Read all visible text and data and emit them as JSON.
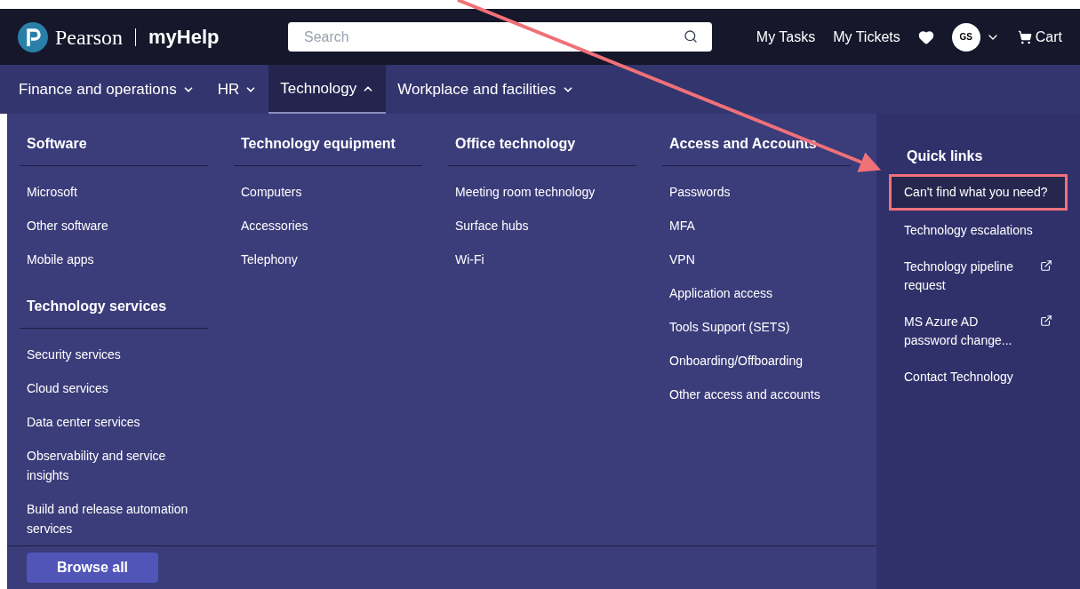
{
  "header": {
    "brand": "Pearson",
    "product": "myHelp",
    "search": {
      "placeholder": "Search"
    },
    "links": [
      "My Tasks",
      "My Tickets"
    ],
    "avatar": "GS",
    "cart": "Cart"
  },
  "nav": [
    {
      "label": "Finance and operations",
      "selected": false
    },
    {
      "label": "HR",
      "selected": false
    },
    {
      "label": "Technology",
      "selected": true
    },
    {
      "label": "Workplace and facilities",
      "selected": false
    }
  ],
  "menu": {
    "columns": [
      [
        {
          "title": "Software",
          "items": [
            "Microsoft",
            "Other software",
            "Mobile apps"
          ]
        },
        {
          "title": "Technology services",
          "items": [
            "Security services",
            "Cloud services",
            "Data center services",
            "Observability and service insights",
            "Build and release automation services"
          ]
        }
      ],
      [
        {
          "title": "Technology equipment",
          "items": [
            "Computers",
            "Accessories",
            "Telephony"
          ]
        }
      ],
      [
        {
          "title": "Office technology",
          "items": [
            "Meeting room technology",
            "Surface hubs",
            "Wi-Fi"
          ]
        }
      ],
      [
        {
          "title": "Access and Accounts",
          "items": [
            "Passwords",
            "MFA",
            "VPN",
            "Application access",
            "Tools Support (SETS)",
            "Onboarding/Offboarding",
            "Other access and accounts"
          ]
        }
      ]
    ],
    "quick_links": {
      "title": "Quick links",
      "items": [
        {
          "label": "Can't find what you need?",
          "external": false,
          "highlighted": true
        },
        {
          "label": "Technology escalations",
          "external": false,
          "highlighted": false
        },
        {
          "label": "Technology pipeline request",
          "external": true,
          "highlighted": false
        },
        {
          "label": "MS Azure AD password change...",
          "external": true,
          "highlighted": false
        },
        {
          "label": "Contact Technology",
          "external": false,
          "highlighted": false
        }
      ]
    },
    "browse_all": "Browse all"
  }
}
